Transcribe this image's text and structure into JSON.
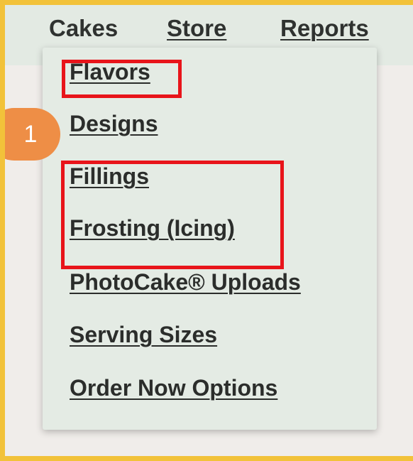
{
  "nav": {
    "items": [
      "Cakes",
      "Store",
      "Reports"
    ]
  },
  "dropdown": {
    "items": [
      "Flavors",
      "Designs",
      "Fillings",
      "Frosting (Icing)",
      "PhotoCake® Uploads",
      "Serving Sizes",
      "Order Now Options"
    ]
  },
  "annotation": {
    "step_number": "1"
  },
  "colors": {
    "frame_border": "#f2c23a",
    "navbar_bg": "#e3eae3",
    "dropdown_bg": "#e4ebe4",
    "highlight": "#e8141a",
    "badge": "#ee8e46"
  }
}
